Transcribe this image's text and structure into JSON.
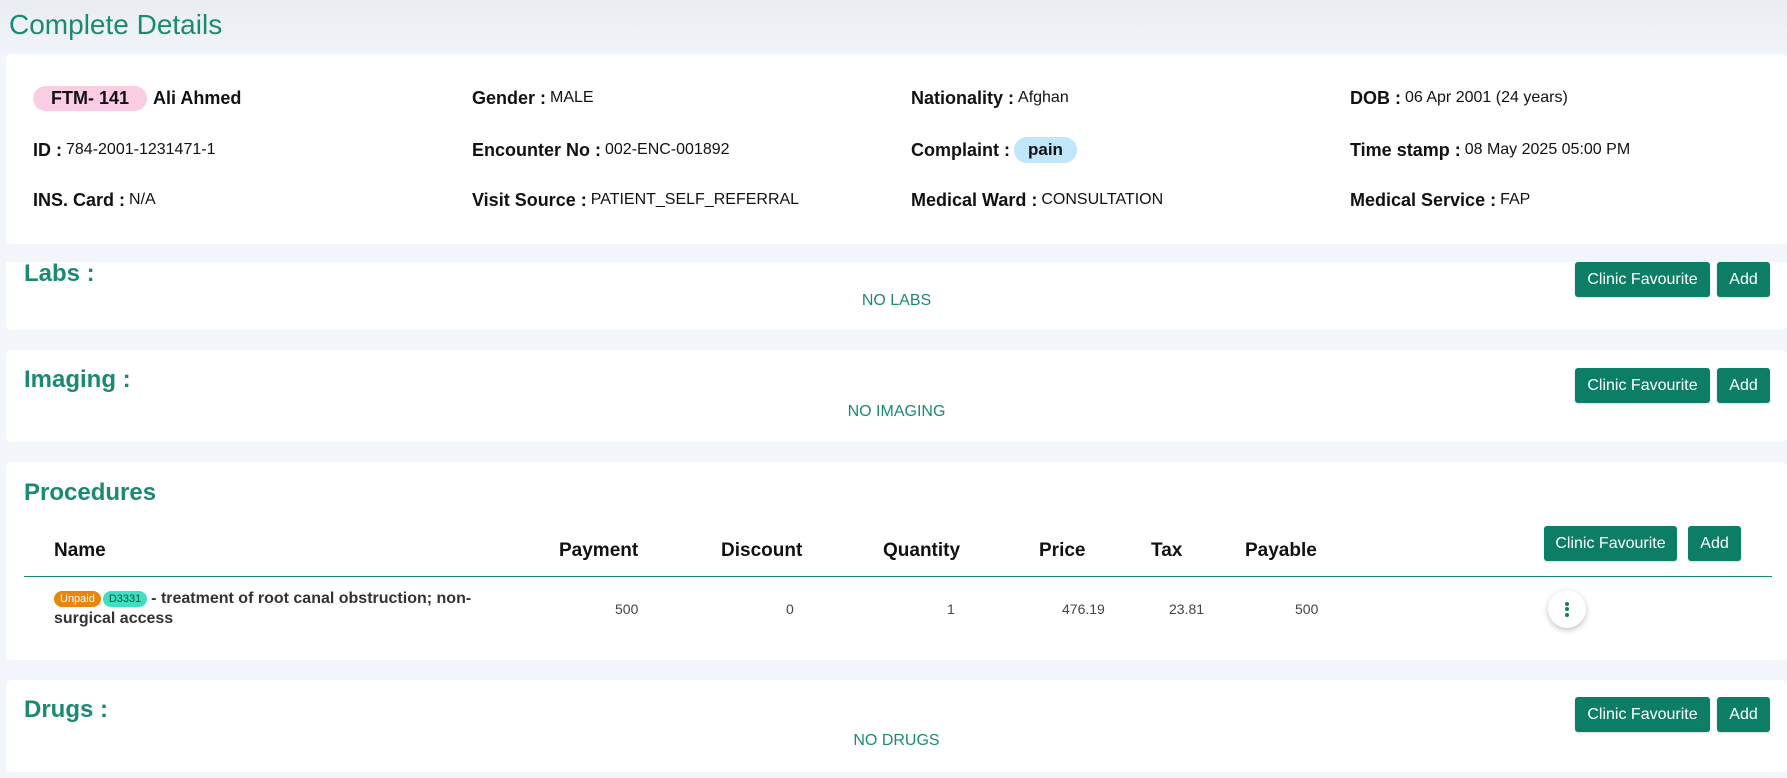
{
  "page": {
    "title": "Complete Details"
  },
  "patient": {
    "ftm_id": "FTM- 141",
    "name": "Ali Ahmed",
    "gender_label": "Gender :",
    "gender": "MALE",
    "nationality_label": "Nationality :",
    "nationality": "Afghan",
    "dob_label": "DOB :",
    "dob": "06 Apr 2001 (24 years)",
    "id_label": "ID :",
    "id": "784-2001-1231471-1",
    "encounter_label": "Encounter No :",
    "encounter": "002-ENC-001892",
    "complaint_label": "Complaint :",
    "complaint": "pain",
    "timestamp_label": "Time stamp :",
    "timestamp": "08 May 2025 05:00 PM",
    "ins_label": "INS. Card :",
    "ins": "N/A",
    "visit_source_label": "Visit Source :",
    "visit_source": "PATIENT_SELF_REFERRAL",
    "ward_label": "Medical Ward :",
    "ward": "CONSULTATION",
    "service_label": "Medical Service :",
    "service": "FAP"
  },
  "buttons": {
    "clinic_favourite": "Clinic Favourite",
    "add": "Add"
  },
  "labs": {
    "title": "Labs :",
    "empty": "NO LABS"
  },
  "imaging": {
    "title": "Imaging :",
    "empty": "NO IMAGING"
  },
  "procedures": {
    "title": "Procedures",
    "columns": [
      "Name",
      "Payment",
      "Discount",
      "Quantity",
      "Price",
      "Tax",
      "Payable"
    ],
    "rows": [
      {
        "status": "Unpaid",
        "code": "D3331",
        "name_line1": "- treatment of root canal obstruction; non-",
        "name_line2": "surgical access",
        "payment": "500",
        "discount": "0",
        "quantity": "1",
        "price": "476.19",
        "tax": "23.81",
        "payable": "500"
      }
    ]
  },
  "drugs": {
    "title": "Drugs :",
    "empty": "NO DRUGS"
  },
  "icons": {
    "row_menu": "kebab-menu-icon"
  },
  "colors": {
    "accent": "#1b8a73",
    "button": "#0d7e66",
    "unpaid": "#e8860e",
    "code": "#3fe0c0",
    "ftm_badge": "#fbcde3",
    "complaint_badge": "#bfe6fb"
  }
}
